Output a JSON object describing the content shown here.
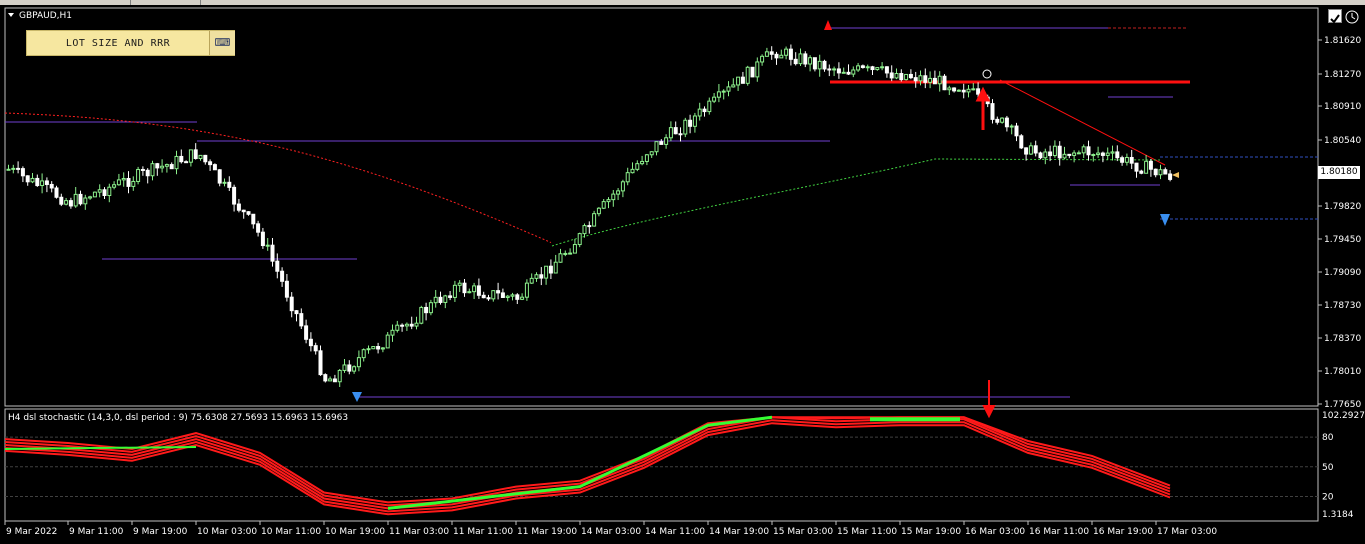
{
  "window": {
    "symbol_title": "GBPAUD,H1",
    "lot_button_label": "LOT SIZE AND RRR",
    "lot_icon": "keyboard-icon",
    "corner_icons": [
      "checkbox-icon",
      "clock-icon"
    ]
  },
  "price_axis": {
    "labels": [
      "1.81620",
      "1.81270",
      "1.80910",
      "1.80540",
      "1.79820",
      "1.79450",
      "1.79090",
      "1.78730",
      "1.78370",
      "1.78010",
      "1.77650"
    ],
    "current_price": "1.80180"
  },
  "time_axis": {
    "labels": [
      "9 Mar 2022",
      "9 Mar 11:00",
      "9 Mar 19:00",
      "10 Mar 03:00",
      "10 Mar 11:00",
      "10 Mar 19:00",
      "11 Mar 03:00",
      "11 Mar 11:00",
      "11 Mar 19:00",
      "14 Mar 03:00",
      "14 Mar 11:00",
      "14 Mar 19:00",
      "15 Mar 03:00",
      "15 Mar 11:00",
      "15 Mar 19:00",
      "16 Mar 03:00",
      "16 Mar 11:00",
      "16 Mar 19:00",
      "17 Mar 03:00"
    ]
  },
  "indicator": {
    "label": "H4 dsl stochastic (14,3,0, dsl period : 9) 75.6308 27.5693 15.6963 15.6963",
    "axis_labels": [
      "102.2927",
      "80",
      "50",
      "20",
      "1.3184"
    ]
  },
  "colors": {
    "bull": "#8cf08c",
    "bear": "#ffffff",
    "support": "#7040d0",
    "resistance": "#ff1010",
    "ma_red": "#ff2020",
    "ma_green": "#40d040",
    "stoch_green": "#33ff33",
    "stoch_red": "#ff1a1a"
  },
  "chart_data": {
    "type": "candlestick",
    "symbol": "GBPAUD",
    "timeframe": "H1",
    "close_path": [
      {
        "t": "9 Mar 2022",
        "price": 1.8022
      },
      {
        "t": "9 Mar 11:00",
        "price": 1.7985
      },
      {
        "t": "9 Mar 19:00",
        "price": 1.8012
      },
      {
        "t": "10 Mar 03:00",
        "price": 1.8039
      },
      {
        "t": "10 Mar 11:00",
        "price": 1.7945
      },
      {
        "t": "10 Mar 19:00",
        "price": 1.779
      },
      {
        "t": "11 Mar 03:00",
        "price": 1.7838
      },
      {
        "t": "11 Mar 11:00",
        "price": 1.7892
      },
      {
        "t": "11 Mar 19:00",
        "price": 1.788
      },
      {
        "t": "14 Mar 03:00",
        "price": 1.795
      },
      {
        "t": "14 Mar 11:00",
        "price": 1.804
      },
      {
        "t": "14 Mar 19:00",
        "price": 1.809
      },
      {
        "t": "15 Mar 03:00",
        "price": 1.815
      },
      {
        "t": "15 Mar 11:00",
        "price": 1.813
      },
      {
        "t": "15 Mar 19:00",
        "price": 1.8125
      },
      {
        "t": "16 Mar 03:00",
        "price": 1.811
      },
      {
        "t": "16 Mar 11:00",
        "price": 1.804
      },
      {
        "t": "16 Mar 19:00",
        "price": 1.804
      },
      {
        "t": "17 Mar 03:00",
        "price": 1.8018
      }
    ],
    "stochastic": {
      "levels": [
        80,
        50,
        20
      ],
      "range": [
        1.3184,
        102.2927
      ],
      "values": [
        72,
        68,
        62,
        78,
        58,
        18,
        8,
        12,
        24,
        30,
        55,
        88,
        100,
        96,
        98,
        98,
        70,
        55,
        25
      ]
    }
  }
}
